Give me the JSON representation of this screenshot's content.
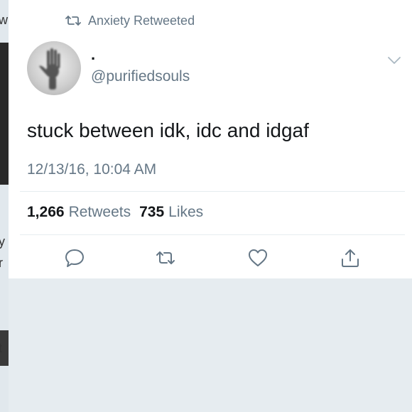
{
  "retweet_header": {
    "text": "Anxiety Retweeted"
  },
  "author": {
    "name": ".",
    "handle": "@purifiedsouls"
  },
  "tweet": {
    "text": "stuck between idk, idc and idgaf",
    "timestamp": "12/13/16, 10:04 AM"
  },
  "stats": {
    "retweets_count": "1,266",
    "retweets_label": "Retweets",
    "likes_count": "735",
    "likes_label": "Likes"
  },
  "background_edge_glyphs": [
    "w",
    "y",
    "r",
    "t"
  ],
  "icons": {
    "retweet_header": "retweet-icon",
    "caret": "chevron-down-icon",
    "reply": "reply-icon",
    "retweet": "retweet-icon",
    "like": "heart-icon",
    "share": "share-icon"
  },
  "colors": {
    "secondary_text": "#657786",
    "primary_text": "#14171a",
    "background": "#e6ecf0"
  }
}
